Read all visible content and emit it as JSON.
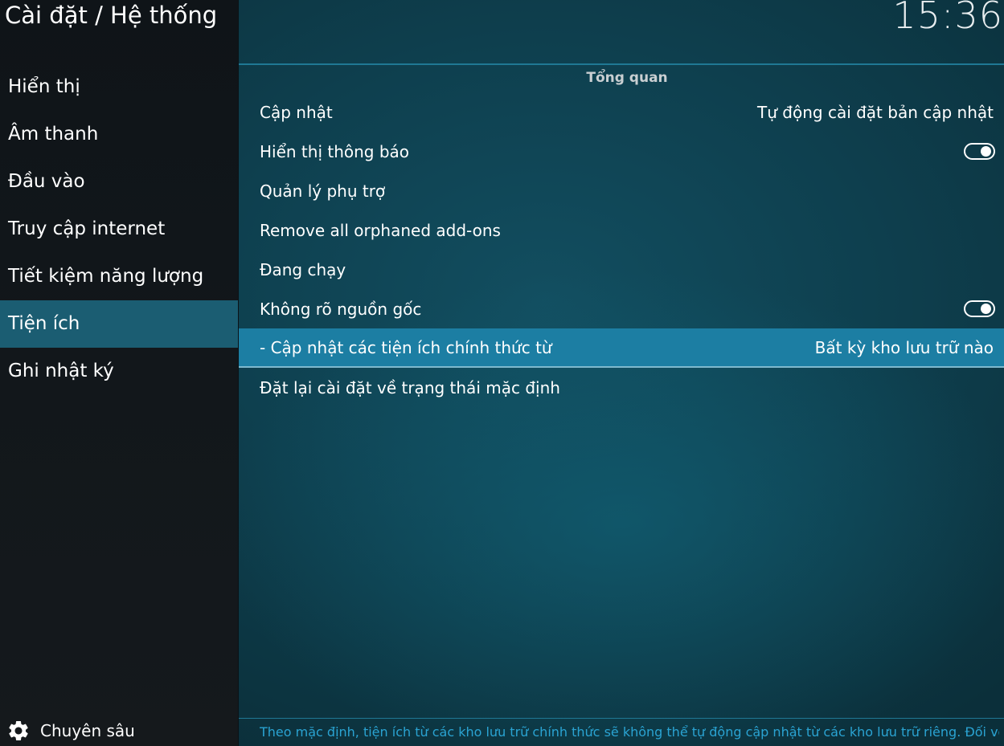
{
  "header": {
    "title": "Cài đặt / Hệ thống",
    "clock": "15:36"
  },
  "sidebar": {
    "items": [
      {
        "label": "Hiển thị",
        "active": false
      },
      {
        "label": "Âm thanh",
        "active": false
      },
      {
        "label": "Đầu vào",
        "active": false
      },
      {
        "label": "Truy cập internet",
        "active": false
      },
      {
        "label": "Tiết kiệm năng lượng",
        "active": false
      },
      {
        "label": "Tiện ích",
        "active": true
      },
      {
        "label": "Ghi nhật ký",
        "active": false
      }
    ],
    "level": {
      "icon": "gear-icon",
      "label": "Chuyên sâu"
    }
  },
  "main": {
    "section_header": "Tổng quan",
    "settings": [
      {
        "label": "Cập nhật",
        "value": "Tự động cài đặt bản cập nhật"
      },
      {
        "label": "Hiển thị thông báo",
        "toggle": true
      },
      {
        "label": "Quản lý phụ trợ"
      },
      {
        "label": "Remove all orphaned add-ons"
      },
      {
        "label": "Đang chạy"
      },
      {
        "label": "Không rõ nguồn gốc",
        "toggle": true
      },
      {
        "label": "- Cập nhật các tiện ích chính thức từ",
        "value": "Bất kỳ kho lưu trữ nào",
        "selected": true
      },
      {
        "label": "Đặt lại cài đặt về trạng thái mặc định"
      }
    ],
    "description": "Theo mặc định, tiện ích từ các kho lưu trữ chính thức sẽ không thể tự động cập nhật từ các kho lưu trữ riêng. Đối với"
  },
  "colors": {
    "accent": "#1c7ea3",
    "sidebar_active": "#1b5d72",
    "description_text": "#2aa3d2"
  }
}
